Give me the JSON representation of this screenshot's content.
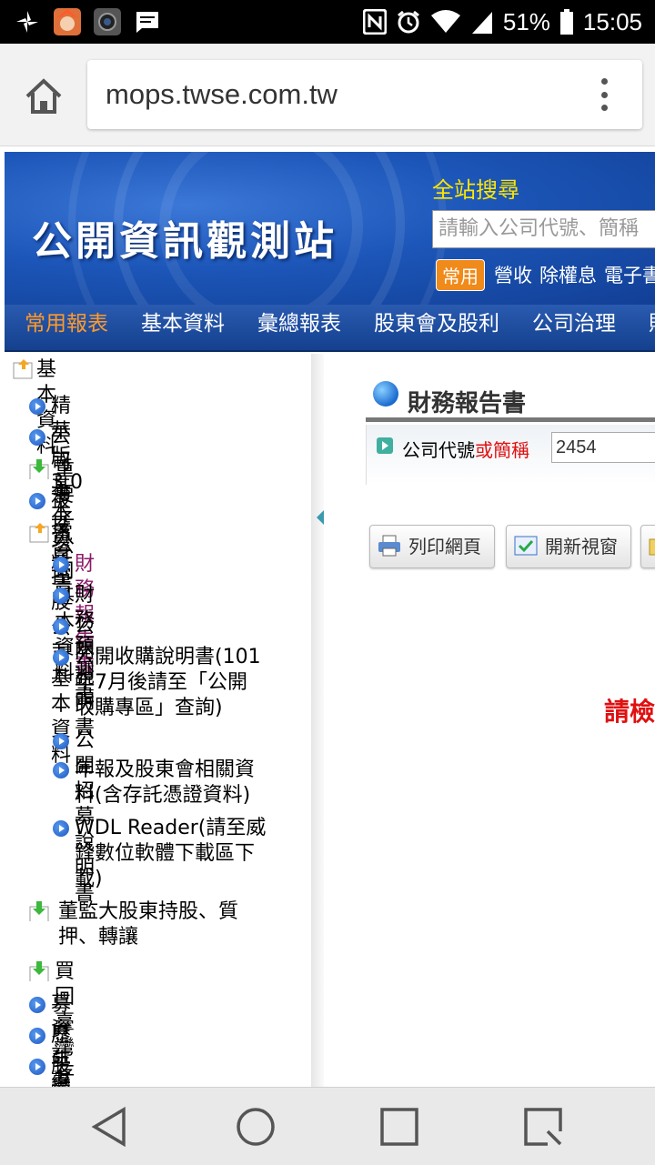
{
  "status_bar": {
    "battery": "51%",
    "time": "15:05",
    "icons": [
      "pinwheel-icon",
      "game-avatar-icon",
      "camera-app-icon",
      "message-icon",
      "nfc-icon",
      "alarm-icon",
      "wifi-icon",
      "signal-icon",
      "battery-icon"
    ]
  },
  "browser": {
    "url": "mops.twse.com.tw"
  },
  "site": {
    "logo": "公開資訊觀測站",
    "search_title": "全站搜尋",
    "search_placeholder": "請輸入公司代號、簡稱",
    "common_badge": "常用",
    "quick_links": [
      "營收",
      "除權息",
      "電子書"
    ],
    "nav": [
      "常用報表",
      "基本資料",
      "彙總報表",
      "股東會及股利",
      "公司治理",
      "財"
    ]
  },
  "sidebar": {
    "items": [
      {
        "label": "基本資料",
        "kind": "folder-open"
      },
      {
        "label": "精華版3.0",
        "kind": "bullet"
      },
      {
        "label": "公司基本資料",
        "kind": "bullet"
      },
      {
        "label": "重要子公司基本資料",
        "kind": "folder-down"
      },
      {
        "label": "被投資控股公司基本資料",
        "kind": "bullet"
      },
      {
        "label": "電子書",
        "kind": "folder-open"
      },
      {
        "label": "財務報告書",
        "kind": "bullet",
        "selected": true
      },
      {
        "label": "財務預測書",
        "kind": "bullet"
      },
      {
        "label": "公開說明書",
        "kind": "bullet"
      },
      {
        "label": "公開收購說明書(101\n年7月後請至「公開\n收購專區」查詢)",
        "kind": "bullet"
      },
      {
        "label": "公開招募說明書",
        "kind": "bullet"
      },
      {
        "label": "年報及股東會相關資\n料(含存託憑證資料)",
        "kind": "bullet"
      },
      {
        "label": "WDL Reader(請至威\n鋒數位軟體下載區下\n載)",
        "kind": "bullet"
      },
      {
        "label": "董監大股東持股、質\n押、轉讓",
        "kind": "folder-down"
      },
      {
        "label": "買回臺灣存託憑證",
        "kind": "folder-down"
      },
      {
        "label": "募資計畫",
        "kind": "bullet"
      },
      {
        "label": "歷年變更登記",
        "kind": "bullet"
      },
      {
        "label": "股權分散表",
        "kind": "bullet"
      }
    ]
  },
  "main": {
    "title": "財務報告書",
    "field_label_a": "公司代號",
    "field_label_b": "或簡稱",
    "code_value": "2454",
    "print_button": "列印網頁",
    "new_window_button": "開新視窗",
    "note": "請檢"
  }
}
